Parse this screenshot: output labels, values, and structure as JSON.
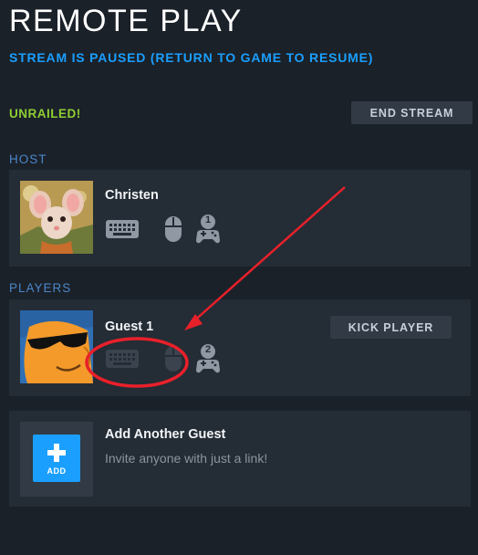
{
  "header": {
    "title": "REMOTE PLAY",
    "status": "STREAM IS PAUSED (RETURN TO GAME TO RESUME)"
  },
  "game": {
    "name": "UNRAILED!",
    "end_stream_label": "END STREAM"
  },
  "host": {
    "section_label": "HOST",
    "name": "Christen",
    "controller_number": "1",
    "avatar_icon": "mouse-character-avatar"
  },
  "players": {
    "section_label": "PLAYERS",
    "guests": [
      {
        "name": "Guest 1",
        "kick_label": "KICK PLAYER",
        "controller_number": "2",
        "avatar_icon": "sunglasses-character-avatar"
      }
    ]
  },
  "add_guest": {
    "title": "Add Another Guest",
    "subtitle": "Invite anyone with just a link!",
    "button_label": "ADD"
  },
  "colors": {
    "background": "#1b2129",
    "card": "#242c35",
    "accent_blue": "#1a9fff",
    "game_green": "#8fce33",
    "section_blue": "#4a86c9",
    "annotation_red": "#e8202a"
  }
}
